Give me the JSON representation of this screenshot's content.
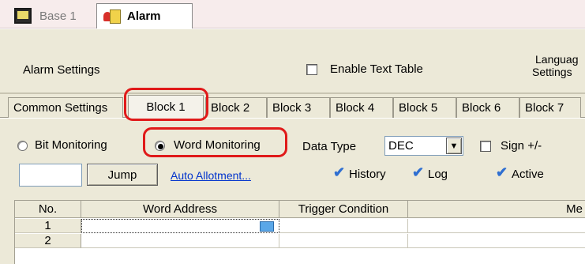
{
  "doc_tabs": [
    {
      "label": "Base 1",
      "icon": "monitor-icon"
    },
    {
      "label": "Alarm",
      "icon": "alarm-icon"
    }
  ],
  "settings": {
    "alarm_settings_label": "Alarm Settings",
    "enable_text_table_label": "Enable Text Table",
    "language_settings_line1": "Languag",
    "language_settings_line2": "Settings"
  },
  "block_tabs": [
    {
      "label": "Common Settings"
    },
    {
      "label": "Block 1"
    },
    {
      "label": "Block 2"
    },
    {
      "label": "Block 3"
    },
    {
      "label": "Block 4"
    },
    {
      "label": "Block 5"
    },
    {
      "label": "Block 6"
    },
    {
      "label": "Block 7"
    }
  ],
  "monitoring": {
    "bit_label": "Bit Monitoring",
    "word_label": "Word Monitoring",
    "data_type_label": "Data Type",
    "data_type_value": "DEC",
    "sign_label": "Sign +/-"
  },
  "jump": {
    "input_value": "",
    "button_label": "Jump",
    "auto_allotment_label": "Auto Allotment..."
  },
  "flags": {
    "history_label": "History",
    "log_label": "Log",
    "active_label": "Active"
  },
  "table": {
    "columns": [
      "No.",
      "Word Address",
      "Trigger Condition",
      "Me"
    ],
    "rows": [
      {
        "no": "1",
        "word_address": "",
        "trigger_condition": "",
        "message": ""
      },
      {
        "no": "2",
        "word_address": "",
        "trigger_condition": "",
        "message": ""
      }
    ]
  },
  "colors": {
    "highlight": "#e01a1a",
    "link": "#0033cc",
    "check": "#2f6fd1"
  }
}
